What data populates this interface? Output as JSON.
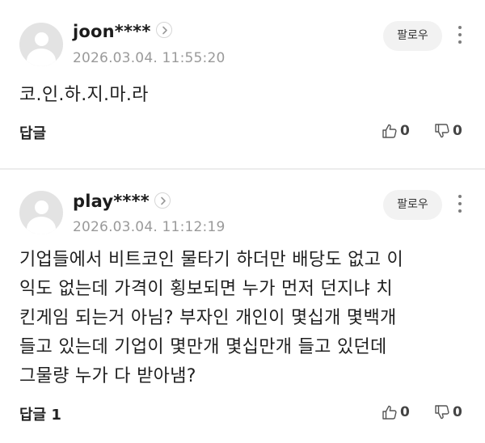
{
  "comments": [
    {
      "username": "joon****",
      "timestamp": "2026.03.04. 11:55:20",
      "follow_label": "팔로우",
      "lines": [
        "코.인.하.지.마.라"
      ],
      "reply_label": "답글",
      "likes": "0",
      "dislikes": "0"
    },
    {
      "username": "play****",
      "timestamp": "2026.03.04. 11:12:19",
      "follow_label": "팔로우",
      "lines": [
        "기업들에서 비트코인 물타기 하더만 배당도 없고 이",
        "익도 없는데 가격이 횡보되면 누가 먼저 던지냐 치",
        "킨게임 되는거 아님? 부자인 개인이 몇십개 몇백개",
        "들고 있는데 기업이 몇만개 몇십만개 들고 있던데",
        "그물량 누가 다 받아냄?"
      ],
      "reply_label": "답글 1",
      "likes": "0",
      "dislikes": "0"
    }
  ],
  "icons": {
    "avatar": "default-profile-icon",
    "chevron": "chevron-right-icon",
    "more": "more-vertical-icon",
    "like": "thumbs-up-icon",
    "dislike": "thumbs-down-icon"
  }
}
